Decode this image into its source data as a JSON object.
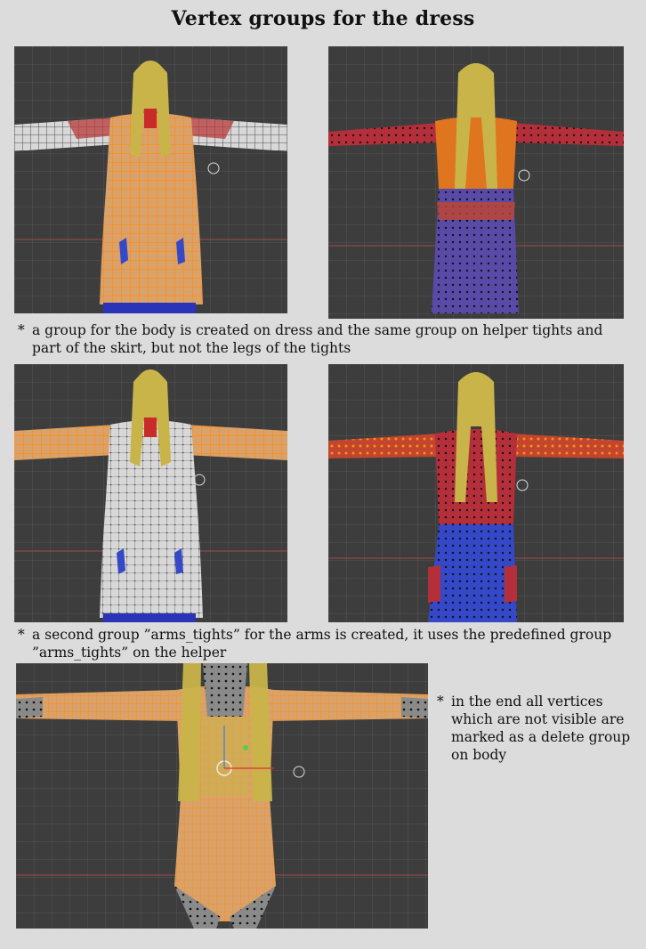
{
  "title": "Vertex groups for the dress",
  "captions": {
    "first": "a group for the body is created on dress and the same group on helper tights and part of the skirt, but not the legs of the tights",
    "second": "a second group ”arms_tights” for the arms is created, it uses the predefined group ”arms_tights” on the helper",
    "third": "in the end all vertices which are not visible are marked as a delete group on body"
  },
  "bullet": "*",
  "screenshots": [
    {
      "name": "dress-body-group-view",
      "content": "dress mesh, body group selected"
    },
    {
      "name": "helper-body-group-view",
      "content": "helper mesh, body group weights"
    },
    {
      "name": "dress-arms-group-view",
      "content": "dress mesh, arms_tights group selected"
    },
    {
      "name": "helper-arms-group-view",
      "content": "helper mesh, arms_tights group weights"
    },
    {
      "name": "body-delete-group-view",
      "content": "body mesh, delete group selected"
    }
  ],
  "colors": {
    "viewport_bg": "#3d3d3d",
    "vertex_selected": "#ff8c1a",
    "vertex_unselected": "#111111",
    "weight_red": "#c23a3a",
    "weight_blue": "#3448c8",
    "hair": "#c9b44a",
    "skin_mesh": "#d9a26a"
  }
}
